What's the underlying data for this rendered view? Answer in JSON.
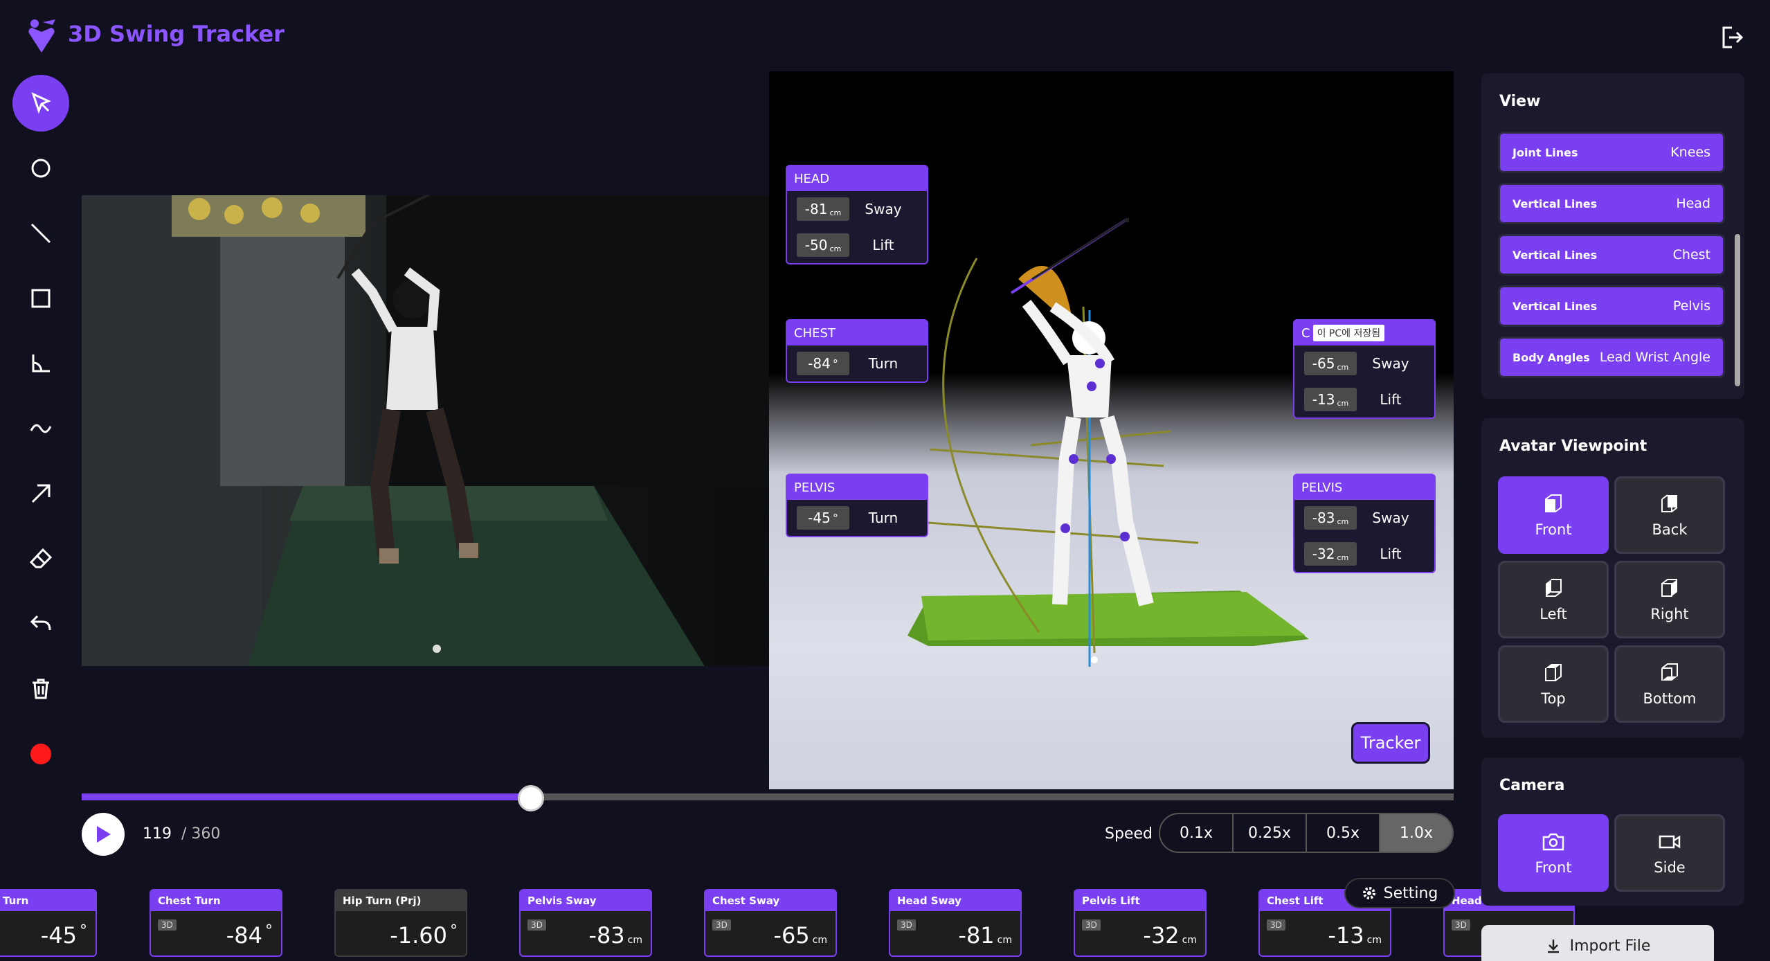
{
  "app": {
    "title": "3D Swing Tracker"
  },
  "colors": {
    "accent": "#7b3ff2",
    "background": "#11101f",
    "record": "#ff1a1a"
  },
  "toolbar": {
    "tools": [
      "select-arrow-icon",
      "circle-icon",
      "line-icon",
      "rectangle-icon",
      "angle-icon",
      "curve-icon",
      "arrow-icon",
      "eraser-icon",
      "undo-icon",
      "trash-icon",
      "record-icon"
    ]
  },
  "panels": {
    "head": {
      "title": "HEAD",
      "sway_value": "-81",
      "sway_unit": "cm",
      "sway_label": "Sway",
      "lift_value": "-50",
      "lift_unit": "cm",
      "lift_label": "Lift"
    },
    "chest_left": {
      "title": "CHEST",
      "turn_value": "-84",
      "turn_unit": "°",
      "turn_label": "Turn"
    },
    "pelvis_left": {
      "title": "PELVIS",
      "turn_value": "-45",
      "turn_unit": "°",
      "turn_label": "Turn"
    },
    "chest_right": {
      "title": "C",
      "tooltip": "이 PC에 저장됨",
      "sway_value": "-65",
      "sway_unit": "cm",
      "sway_label": "Sway",
      "lift_value": "-13",
      "lift_unit": "cm",
      "lift_label": "Lift"
    },
    "pelvis_right": {
      "title": "PELVIS",
      "sway_value": "-83",
      "sway_unit": "cm",
      "sway_label": "Sway",
      "lift_value": "-32",
      "lift_unit": "cm",
      "lift_label": "Lift"
    }
  },
  "tracker_button": "Tracker",
  "playback": {
    "frame_current": "119",
    "frame_total": "/ 360",
    "progress": 0.33,
    "speed_label": "Speed",
    "speeds": [
      "0.1x",
      "0.25x",
      "0.5x",
      "1.0x"
    ],
    "speed_selected": "1.0x"
  },
  "metrics": [
    {
      "title": "Turn",
      "badge": "",
      "value": "-45",
      "unit": "°"
    },
    {
      "title": "Chest Turn",
      "badge": "3D",
      "value": "-84",
      "unit": "°"
    },
    {
      "title": "Hip Turn (Prj)",
      "badge": "",
      "value": "-1.60",
      "unit": "°"
    },
    {
      "title": "Pelvis Sway",
      "badge": "3D",
      "value": "-83",
      "unit": "cm"
    },
    {
      "title": "Chest Sway",
      "badge": "3D",
      "value": "-65",
      "unit": "cm"
    },
    {
      "title": "Head Sway",
      "badge": "3D",
      "value": "-81",
      "unit": "cm"
    },
    {
      "title": "Pelvis Lift",
      "badge": "3D",
      "value": "-32",
      "unit": "cm"
    },
    {
      "title": "Chest Lift",
      "badge": "3D",
      "value": "-13",
      "unit": "cm"
    },
    {
      "title": "Head L",
      "badge": "3D",
      "value": "",
      "unit": ""
    }
  ],
  "setting_button": "Setting",
  "view": {
    "title": "View",
    "items": [
      {
        "key": "Joint Lines",
        "value": "Knees"
      },
      {
        "key": "Vertical Lines",
        "value": "Head"
      },
      {
        "key": "Vertical Lines",
        "value": "Chest"
      },
      {
        "key": "Vertical Lines",
        "value": "Pelvis"
      },
      {
        "key": "Body Angles",
        "value": "Lead Wrist Angle"
      }
    ]
  },
  "avatar_viewpoint": {
    "title": "Avatar Viewpoint",
    "options": [
      "Front",
      "Back",
      "Left",
      "Right",
      "Top",
      "Bottom"
    ],
    "selected": "Front"
  },
  "camera": {
    "title": "Camera",
    "options": [
      "Front",
      "Side"
    ],
    "selected": "Front"
  },
  "import_button": "Import File"
}
